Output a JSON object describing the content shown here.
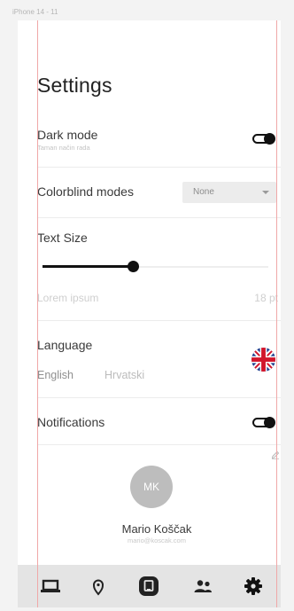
{
  "frame": {
    "label": "iPhone 14 - 11"
  },
  "page": {
    "title": "Settings"
  },
  "dark_mode": {
    "label": "Dark mode",
    "sublabel": "Taman način rada",
    "enabled": true
  },
  "colorblind": {
    "label": "Colorblind modes",
    "selected": "None"
  },
  "text_size": {
    "label": "Text Size",
    "preview_text": "Lorem ipsum",
    "value_text": "18 pt",
    "slider_fraction": 0.4
  },
  "language": {
    "label": "Language",
    "options": [
      "English",
      "Hrvatski"
    ],
    "selected": "English",
    "flag_icon": "uk-flag-icon"
  },
  "notifications": {
    "label": "Notifications",
    "enabled": true
  },
  "profile": {
    "initials": "MK",
    "name": "Mario Koščak",
    "email": "mario@koscak.com"
  },
  "tabbar": {
    "items": [
      {
        "icon": "laptop-icon",
        "active": false
      },
      {
        "icon": "location-pin-icon",
        "active": false
      },
      {
        "icon": "tablet-icon",
        "active": false
      },
      {
        "icon": "people-icon",
        "active": false
      },
      {
        "icon": "gear-icon",
        "active": true
      }
    ]
  },
  "colors": {
    "guide": "#f0a8a8",
    "toggle": "#111111",
    "tabbar_bg": "#e4e4e4"
  }
}
